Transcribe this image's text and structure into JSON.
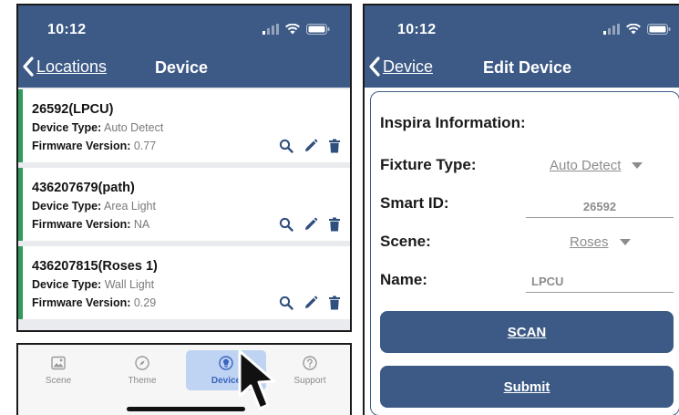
{
  "left_screen": {
    "status": {
      "time": "10:12"
    },
    "nav": {
      "back_label": "Locations",
      "title": "Device"
    },
    "devices": [
      {
        "name": "26592(LPCU)",
        "type_label": "Device Type:",
        "type_value": "Auto Detect",
        "fw_label": "Firmware Version:",
        "fw_value": "0.77"
      },
      {
        "name": "436207679(path)",
        "type_label": "Device Type:",
        "type_value": "Area Light",
        "fw_label": "Firmware Version:",
        "fw_value": "NA"
      },
      {
        "name": "436207815(Roses 1)",
        "type_label": "Device Type:",
        "type_value": "Wall Light",
        "fw_label": "Firmware Version:",
        "fw_value": "0.29"
      }
    ]
  },
  "tabbar": {
    "tabs": [
      {
        "label": "Scene",
        "icon": "image-icon"
      },
      {
        "label": "Theme",
        "icon": "compass-icon"
      },
      {
        "label": "Device",
        "icon": "bulb-icon",
        "active": true
      },
      {
        "label": "Support",
        "icon": "help-icon"
      }
    ]
  },
  "right_screen": {
    "status": {
      "time": "10:12"
    },
    "nav": {
      "back_label": "Device",
      "title": "Edit Device"
    },
    "form": {
      "heading": "Inspira Information:",
      "fixture_type_label": "Fixture Type:",
      "fixture_type_value": "Auto Detect",
      "smart_id_label": "Smart ID:",
      "smart_id_value": "26592",
      "scene_label": "Scene:",
      "scene_value": "Roses",
      "name_label": "Name:",
      "name_value": "LPCU",
      "scan_label": "SCAN",
      "submit_label": "Submit"
    }
  },
  "colors": {
    "primary": "#3c5a85",
    "accent_green": "#2f9a5b",
    "active_tab_bg": "#bfd3f2"
  }
}
